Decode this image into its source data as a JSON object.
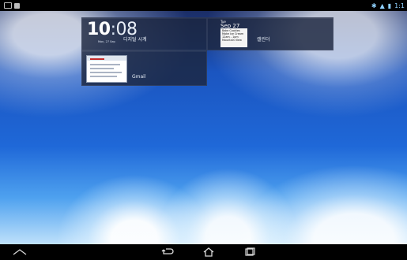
{
  "status_bar": {
    "left_icons": [
      "notification-icon",
      "screenshot-icon"
    ],
    "time": "1:1"
  },
  "widgets": {
    "clock": {
      "hour": "10",
      "minute": "08",
      "label": "디지털 시계",
      "date": "Mon, 27 Sep"
    },
    "calendar": {
      "weekday": "Tue",
      "date": "Sep 27",
      "label": "캘린더",
      "events": [
        "Bake Cookies",
        "Make Ice Cream",
        "12am - 1pm",
        "Mountain View"
      ]
    },
    "gmail": {
      "label": "Gmail"
    }
  },
  "navigation": {
    "icons": [
      "collapse-icon",
      "back-icon",
      "home-icon",
      "recent-apps-icon"
    ]
  }
}
